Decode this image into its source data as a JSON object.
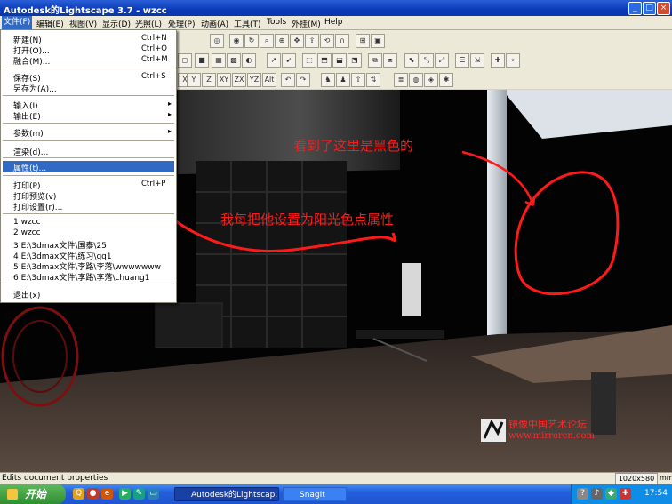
{
  "window": {
    "title": "Autodesk的Lightscape 3.7 - wzcc",
    "controls": [
      "_",
      "□",
      "×"
    ]
  },
  "menubar": [
    "文件(F)",
    "编辑(E)",
    "视图(V)",
    "显示(D)",
    "光照(L)",
    "处理(P)",
    "动画(A)",
    "工具(T)",
    "Tools",
    "外挂(M)",
    "Help"
  ],
  "file_menu": {
    "items": [
      {
        "label": "新建(N)",
        "shortcut": "Ctrl+N"
      },
      {
        "label": "打开(O)...",
        "shortcut": "Ctrl+O"
      },
      {
        "label": "融合(M)...",
        "shortcut": "Ctrl+M"
      },
      {
        "label": "保存(S)",
        "shortcut": "Ctrl+S"
      },
      {
        "label": "另存为(A)...",
        "shortcut": ""
      },
      {
        "label": "输入(I)",
        "shortcut": ""
      },
      {
        "label": "输出(E)",
        "shortcut": ""
      },
      {
        "label": "参数(m)",
        "shortcut": ""
      },
      {
        "label": "渲染(d)...",
        "shortcut": ""
      },
      {
        "label": "属性(t)...",
        "shortcut": ""
      },
      {
        "label": "打印(P)...",
        "shortcut": "Ctrl+P"
      },
      {
        "label": "打印预览(v)",
        "shortcut": ""
      },
      {
        "label": "打印设置(r)...",
        "shortcut": ""
      },
      {
        "label": "1 wzcc",
        "shortcut": ""
      },
      {
        "label": "2 wzcc",
        "shortcut": ""
      },
      {
        "label": "3 E:\\3dmax文件\\国泰\\25",
        "shortcut": ""
      },
      {
        "label": "4 E:\\3dmax文件\\练习\\qq1",
        "shortcut": ""
      },
      {
        "label": "5 E:\\3dmax文件\\李路\\李落\\wwwwwww",
        "shortcut": ""
      },
      {
        "label": "6 E:\\3dmax文件\\李路\\李落\\chuang1",
        "shortcut": ""
      },
      {
        "label": "退出(x)",
        "shortcut": ""
      }
    ]
  },
  "toolbar_labels": [
    "X",
    "Y",
    "Z",
    "XY",
    "ZX",
    "YZ",
    "Alt"
  ],
  "annotations": {
    "note1": "看到了这里是黑色的",
    "note2": "我每把他设置为阳光色点属性"
  },
  "watermark": {
    "text": "镜像中国艺术论坛",
    "url": "www.mirrorcn.com"
  },
  "statusbar": {
    "text": "Edits document properties",
    "resolution": "1020x580",
    "unit": "mm"
  },
  "taskbar": {
    "start": "开始",
    "tasks": [
      "Autodesk的Lightscap...",
      "SnagIt"
    ],
    "clock": "17:54"
  },
  "colors": {
    "annotation": "#ff1a1a",
    "menu_highlight": "#316ac5",
    "title_bar": "#0b3bb8"
  }
}
